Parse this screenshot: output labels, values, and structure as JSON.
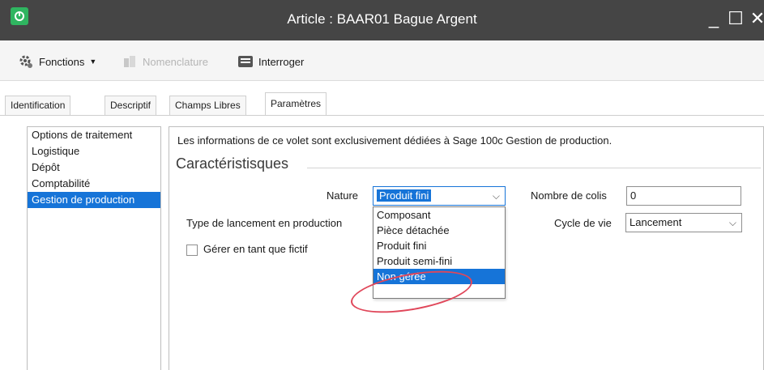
{
  "window": {
    "title": "Article : BAAR01 Bague Argent",
    "minimize_glyph": "_",
    "maximize_glyph": "☐",
    "close_glyph": "✕"
  },
  "toolbar": {
    "fonctions_label": "Fonctions",
    "nomenclature_label": "Nomenclature",
    "interroger_label": "Interroger"
  },
  "tabs": [
    {
      "label": "Identification"
    },
    {
      "label": "Descriptif"
    },
    {
      "label": "Champs Libres"
    },
    {
      "label": "Paramètres"
    }
  ],
  "sidebar": {
    "items": [
      {
        "label": "Options de traitement"
      },
      {
        "label": "Logistique"
      },
      {
        "label": "Dépôt"
      },
      {
        "label": "Comptabilité"
      },
      {
        "label": "Gestion de production"
      }
    ]
  },
  "panel": {
    "info": "Les informations de ce volet sont exclusivement dédiées à Sage 100c Gestion de production.",
    "section_title": "Caractéristisques",
    "nature_label": "Nature",
    "nature_value": "Produit fini",
    "nombre_colis_label": "Nombre de colis",
    "nombre_colis_value": "0",
    "type_lancement_label": "Type de lancement en production",
    "cycle_vie_label": "Cycle de vie",
    "cycle_vie_value": "Lancement",
    "gerer_fictif_label": "Gérer en tant que fictif"
  },
  "dropdown": {
    "options": [
      {
        "label": "Composant"
      },
      {
        "label": "Pièce détachée"
      },
      {
        "label": "Produit fini"
      },
      {
        "label": "Produit semi-fini"
      },
      {
        "label": "Non gérée"
      }
    ]
  },
  "colors": {
    "titlebar": "#454545",
    "accent": "#1674d8",
    "annotation": "#e0475a"
  }
}
